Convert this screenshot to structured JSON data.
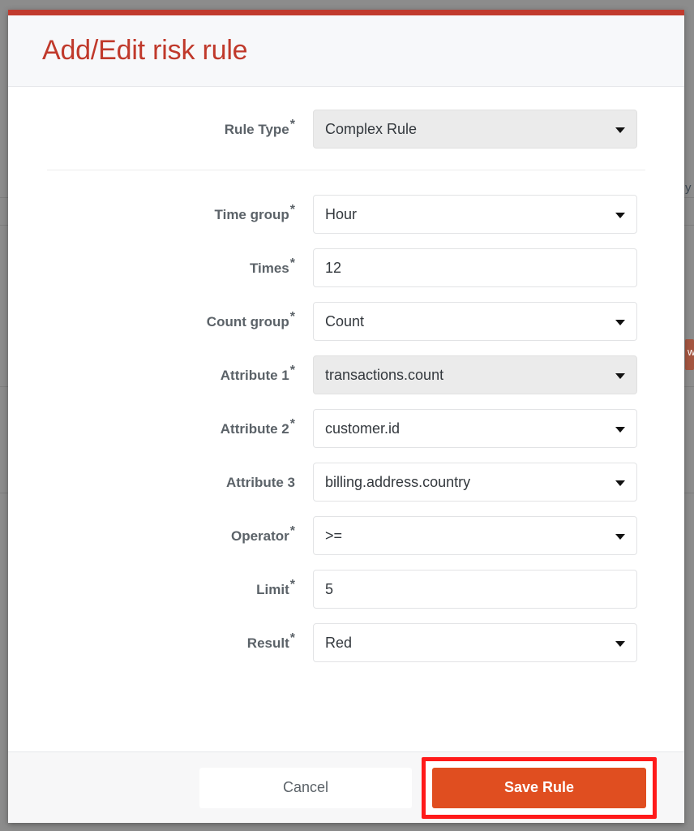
{
  "modal": {
    "title": "Add/Edit risk rule",
    "accent_color": "#c0392b",
    "topbar_color": "#c13b2e"
  },
  "form": {
    "rule_type": {
      "label": "Rule Type",
      "required": true,
      "value": "Complex Rule",
      "control": "select",
      "disabled": true
    },
    "fields": [
      {
        "label": "Time group",
        "required": true,
        "value": "Hour",
        "control": "select",
        "disabled": false
      },
      {
        "label": "Times",
        "required": true,
        "value": "12",
        "control": "input",
        "disabled": false
      },
      {
        "label": "Count group",
        "required": true,
        "value": "Count",
        "control": "select",
        "disabled": false
      },
      {
        "label": "Attribute 1",
        "required": true,
        "value": "transactions.count",
        "control": "select",
        "disabled": true
      },
      {
        "label": "Attribute 2",
        "required": true,
        "value": "customer.id",
        "control": "select",
        "disabled": false
      },
      {
        "label": "Attribute 3",
        "required": false,
        "value": "billing.address.country",
        "control": "select",
        "disabled": false
      },
      {
        "label": "Operator",
        "required": true,
        "value": ">=",
        "control": "select",
        "disabled": false
      },
      {
        "label": "Limit",
        "required": true,
        "value": "5",
        "control": "input",
        "disabled": false
      },
      {
        "label": "Result",
        "required": true,
        "value": "Red",
        "control": "select",
        "disabled": false
      }
    ],
    "required_marker": "*"
  },
  "footer": {
    "cancel_label": "Cancel",
    "save_label": "Save Rule",
    "save_color": "#e04e20",
    "highlight_color": "#ff1a1a"
  },
  "backdrop": {
    "glyph": "y",
    "button_color": "#a45540",
    "button_glyph": "w"
  }
}
